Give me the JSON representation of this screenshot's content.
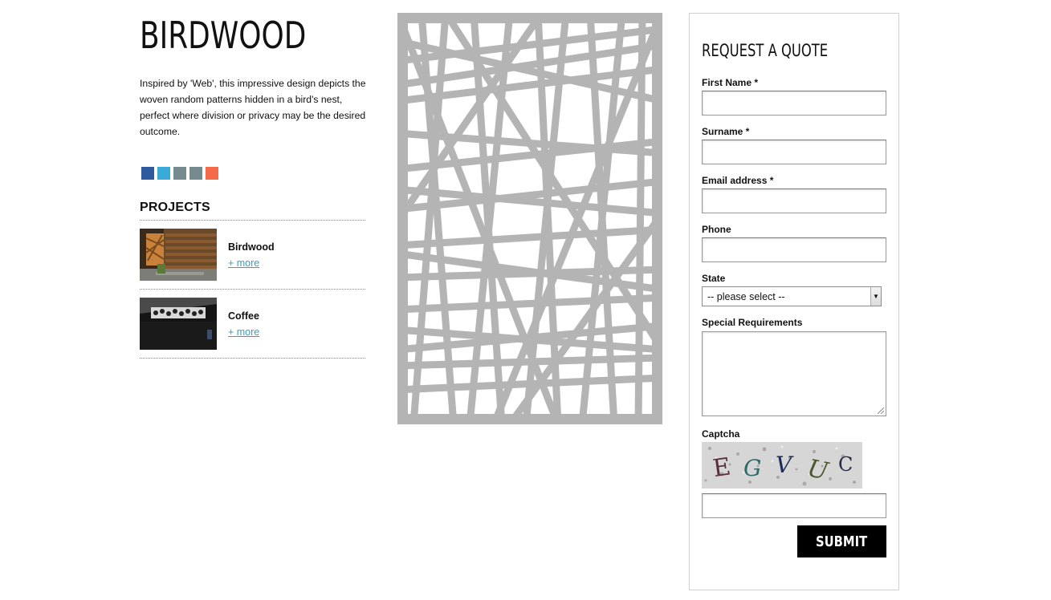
{
  "product": {
    "title": "BIRDWOOD",
    "description": "Inspired by 'Web', this impressive design depicts the woven random patterns hidden in a bird's nest, perfect where division or privacy may be the desired outcome."
  },
  "social": [
    {
      "icon": "facebook-icon",
      "color": "#2f5a9e"
    },
    {
      "icon": "twitter-icon",
      "color": "#3aaad8"
    },
    {
      "icon": "share-icon",
      "color": "#758a8f"
    },
    {
      "icon": "email-icon",
      "color": "#758a8f"
    },
    {
      "icon": "google-plus-icon",
      "color": "#f56b4a"
    }
  ],
  "projects": {
    "heading": "PROJECTS",
    "items": [
      {
        "name": "Birdwood",
        "more": "+ more"
      },
      {
        "name": "Coffee",
        "more": "+ more"
      }
    ]
  },
  "panel": {
    "color": "#b4b4b4"
  },
  "form": {
    "title": "REQUEST A QUOTE",
    "first_name_label": "First Name *",
    "surname_label": "Surname *",
    "email_label": "Email address *",
    "phone_label": "Phone",
    "state_label": "State",
    "state_value": "-- please select --",
    "special_label": "Special Requirements",
    "captcha_label": "Captcha",
    "captcha_chars": [
      "E",
      "G",
      "V",
      "U",
      "C"
    ],
    "submit_label": "SUBMIT"
  }
}
